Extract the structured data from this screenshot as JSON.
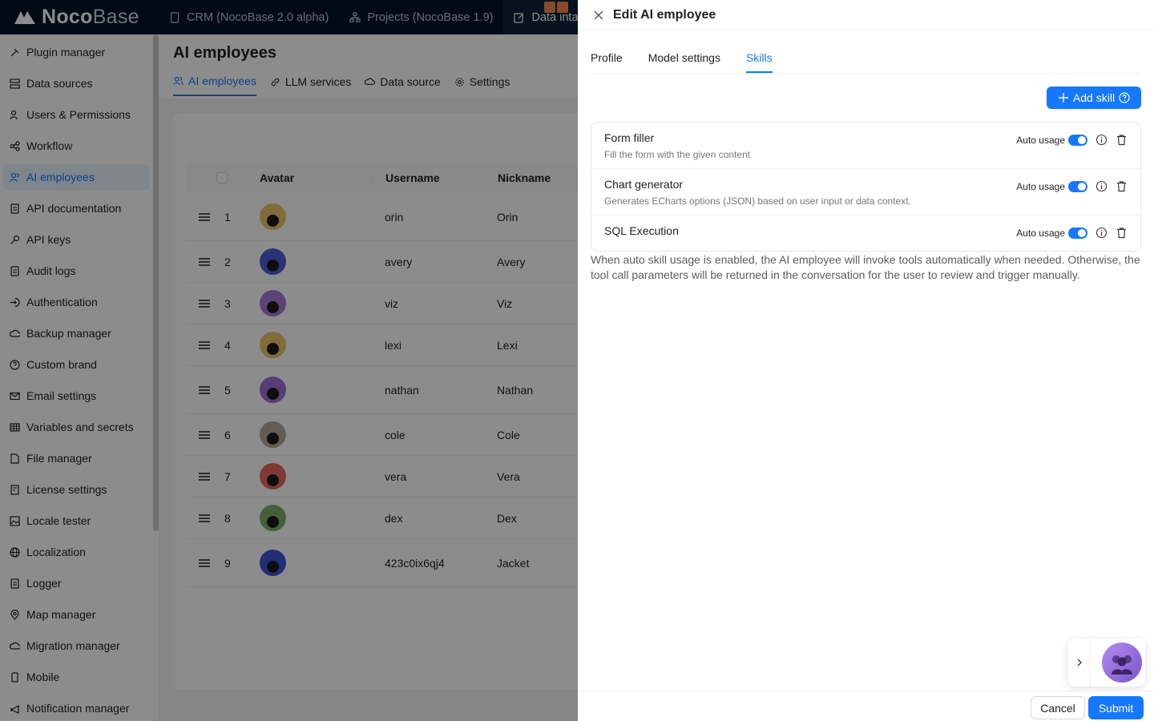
{
  "topbar": {
    "logo_bold": "Noco",
    "logo_light": "Base",
    "nav": [
      {
        "label": "CRM (NocoBase 2.0 alpha)",
        "icon": "file-icon"
      },
      {
        "label": "Projects (NocoBase 1.9)",
        "icon": "sitemap-icon"
      },
      {
        "label": "Data intake",
        "icon": "edit-icon"
      }
    ]
  },
  "sidebar": {
    "items": [
      {
        "label": "Plugin manager",
        "icon": "plug-icon"
      },
      {
        "label": "Data sources",
        "icon": "database-icon"
      },
      {
        "label": "Users & Permissions",
        "icon": "users-icon"
      },
      {
        "label": "Workflow",
        "icon": "workflow-icon"
      },
      {
        "label": "AI employees",
        "icon": "ai-icon"
      },
      {
        "label": "API documentation",
        "icon": "document-icon"
      },
      {
        "label": "API keys",
        "icon": "key-icon"
      },
      {
        "label": "Audit logs",
        "icon": "document-icon"
      },
      {
        "label": "Authentication",
        "icon": "login-icon"
      },
      {
        "label": "Backup manager",
        "icon": "cloud-icon"
      },
      {
        "label": "Custom brand",
        "icon": "question-icon"
      },
      {
        "label": "Email settings",
        "icon": "mail-icon"
      },
      {
        "label": "Variables and secrets",
        "icon": "table-icon"
      },
      {
        "label": "File manager",
        "icon": "file-icon"
      },
      {
        "label": "License settings",
        "icon": "license-icon"
      },
      {
        "label": "Locale tester",
        "icon": "image-icon"
      },
      {
        "label": "Localization",
        "icon": "globe-icon"
      },
      {
        "label": "Logger",
        "icon": "document-icon"
      },
      {
        "label": "Map manager",
        "icon": "pin-icon"
      },
      {
        "label": "Migration manager",
        "icon": "cloud-icon"
      },
      {
        "label": "Mobile",
        "icon": "mobile-icon"
      },
      {
        "label": "Notification manager",
        "icon": "notification-icon"
      }
    ],
    "active_index": 4
  },
  "main": {
    "title": "AI employees",
    "tabs": [
      "AI employees",
      "LLM services",
      "Data source",
      "Settings"
    ],
    "table": {
      "columns": [
        "Avatar",
        "Username",
        "Nickname"
      ],
      "rows": [
        {
          "index": "1",
          "username": "orin",
          "nickname": "Orin",
          "color": "#e9c46a"
        },
        {
          "index": "2",
          "username": "avery",
          "nickname": "Avery",
          "color": "#4f5bd5"
        },
        {
          "index": "3",
          "username": "viz",
          "nickname": "Viz",
          "color": "#a77bd8"
        },
        {
          "index": "4",
          "username": "lexi",
          "nickname": "Lexi",
          "color": "#e9c46a"
        },
        {
          "index": "5",
          "username": "nathan",
          "nickname": "Nathan",
          "color": "#9b6fd8"
        },
        {
          "index": "6",
          "username": "cole",
          "nickname": "Cole",
          "color": "#b5a89a"
        },
        {
          "index": "7",
          "username": "vera",
          "nickname": "Vera",
          "color": "#e56b5d"
        },
        {
          "index": "8",
          "username": "dex",
          "nickname": "Dex",
          "color": "#7fb069"
        },
        {
          "index": "9",
          "username": "423c0ix6qj4",
          "nickname": "Jacket",
          "color": "#3d54d8"
        }
      ]
    }
  },
  "drawer": {
    "title": "Edit AI employee",
    "tabs": [
      "Profile",
      "Model settings",
      "Skills"
    ],
    "active_tab": "Skills",
    "add_skill_label": "Add skill",
    "auto_usage_label": "Auto usage",
    "skills": [
      {
        "name": "Form filler",
        "description": "Fill the form with the given content",
        "auto_usage": true
      },
      {
        "name": "Chart generator",
        "description": "Generates ECharts options (JSON) based on user input or data context.",
        "auto_usage": true
      },
      {
        "name": "SQL Execution",
        "description": "",
        "auto_usage": true
      }
    ],
    "note": "When auto skill usage is enabled, the AI employee will invoke tools automatically when needed. Otherwise, the tool call parameters will be returned in the conversation for the user to review and trigger manually.",
    "cancel_label": "Cancel",
    "submit_label": "Submit"
  },
  "colors": {
    "primary": "#1677ff",
    "topbar_bg": "#001529"
  }
}
